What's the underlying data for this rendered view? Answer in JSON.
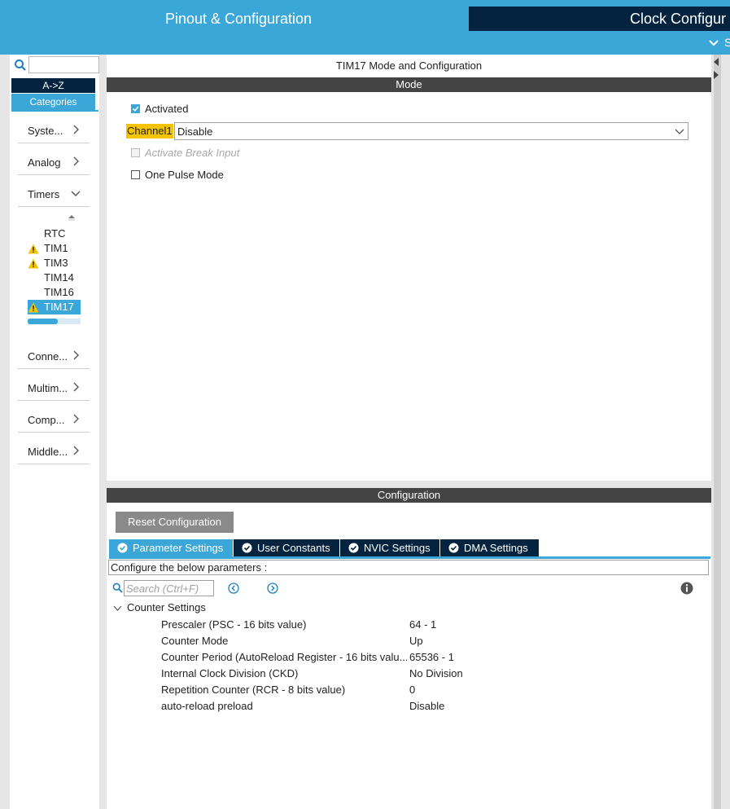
{
  "top_tabs": {
    "pinout": "Pinout & Configuration",
    "clock": "Clock Configur",
    "subtab_chevron": "chevron-down-icon",
    "subtab_text": "S"
  },
  "sidebar": {
    "search_value": "",
    "sort_az": "A->Z",
    "categories_btn": "Categories",
    "categories": [
      {
        "label": "Syste...",
        "expanded": false
      },
      {
        "label": "Analog",
        "expanded": false
      },
      {
        "label": "Timers",
        "expanded": true
      },
      {
        "label": "Conne...",
        "expanded": false
      },
      {
        "label": "Multim...",
        "expanded": false
      },
      {
        "label": "Comp...",
        "expanded": false
      },
      {
        "label": "Middle...",
        "expanded": false
      }
    ],
    "peripherals": [
      {
        "label": "RTC",
        "warning": false
      },
      {
        "label": "TIM1",
        "warning": true
      },
      {
        "label": "TIM3",
        "warning": true
      },
      {
        "label": "TIM14",
        "warning": false
      },
      {
        "label": "TIM16",
        "warning": false
      },
      {
        "label": "TIM17",
        "warning": true,
        "selected": true
      }
    ],
    "scroll_progress": 0.57
  },
  "mode": {
    "title": "TIM17 Mode and Configuration",
    "section": "Mode",
    "activated": {
      "label": "Activated",
      "checked": true
    },
    "channel1": {
      "label": "Channel1",
      "value": "Disable"
    },
    "break_input": {
      "label": "Activate Break Input",
      "checked": false,
      "disabled": true
    },
    "one_pulse": {
      "label": "One Pulse Mode",
      "checked": false
    }
  },
  "config": {
    "section": "Configuration",
    "reset_button": "Reset Configuration",
    "tabs": [
      {
        "label": "Parameter Settings",
        "active": true
      },
      {
        "label": "User Constants",
        "active": false
      },
      {
        "label": "NVIC Settings",
        "active": false
      },
      {
        "label": "DMA Settings",
        "active": false
      }
    ],
    "description": "Configure the below parameters :",
    "search_placeholder": "Search (Ctrl+F)",
    "group": "Counter Settings",
    "params": [
      {
        "name": "Prescaler (PSC - 16 bits value)",
        "value": "64 - 1"
      },
      {
        "name": "Counter Mode",
        "value": "Up"
      },
      {
        "name": "Counter Period (AutoReload Register - 16 bits valu...",
        "value": "65536 - 1"
      },
      {
        "name": "Internal Clock Division (CKD)",
        "value": "No Division"
      },
      {
        "name": "Repetition Counter (RCR - 8 bits value)",
        "value": "0"
      },
      {
        "name": "auto-reload preload",
        "value": "Disable"
      }
    ]
  },
  "colors": {
    "accent": "#3ba6d8",
    "dark_navy": "#04233f",
    "section_bar": "#444444",
    "highlight": "#f5c400"
  }
}
